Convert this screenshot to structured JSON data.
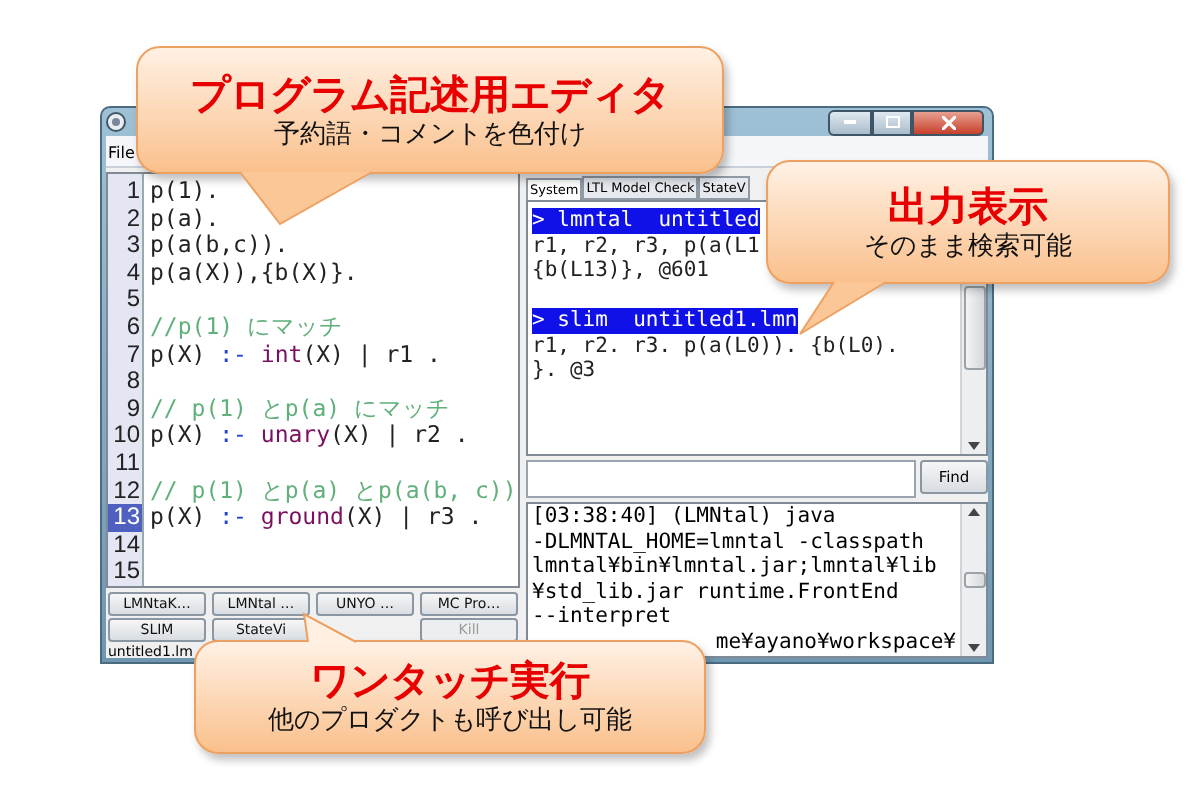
{
  "window": {
    "menu": [
      "File"
    ],
    "editor": {
      "lines": [
        {
          "number": "1",
          "current": false,
          "tokens": [
            {
              "kind": "plain",
              "text": "p(1)."
            }
          ]
        },
        {
          "number": "2",
          "current": false,
          "tokens": [
            {
              "kind": "plain",
              "text": "p(a)."
            }
          ]
        },
        {
          "number": "3",
          "current": false,
          "tokens": [
            {
              "kind": "plain",
              "text": "p(a(b,c))."
            }
          ]
        },
        {
          "number": "4",
          "current": false,
          "tokens": [
            {
              "kind": "plain",
              "text": "p(a(X)),{b(X)}."
            }
          ]
        },
        {
          "number": "5",
          "current": false
        },
        {
          "number": "6",
          "current": false,
          "tokens": [
            {
              "kind": "comment",
              "text": "//p(1) にマッチ"
            }
          ]
        },
        {
          "number": "7",
          "current": false,
          "tokens": [
            {
              "kind": "plain",
              "text": "p(X) "
            },
            {
              "kind": "operator",
              "text": ":- "
            },
            {
              "kind": "keyword",
              "text": "int"
            },
            {
              "kind": "plain",
              "text": "(X) | r1 ."
            }
          ]
        },
        {
          "number": "8",
          "current": false
        },
        {
          "number": "9",
          "current": false,
          "tokens": [
            {
              "kind": "comment",
              "text": "// p(1) とp(a) にマッチ"
            }
          ]
        },
        {
          "number": "10",
          "current": false,
          "tokens": [
            {
              "kind": "plain",
              "text": "p(X) "
            },
            {
              "kind": "operator",
              "text": ":- "
            },
            {
              "kind": "keyword",
              "text": "unary"
            },
            {
              "kind": "plain",
              "text": "(X) | r2 ."
            }
          ]
        },
        {
          "number": "11",
          "current": false
        },
        {
          "number": "12",
          "current": false,
          "tokens": [
            {
              "kind": "comment",
              "text": "// p(1) とp(a) とp(a(b, c))"
            }
          ]
        },
        {
          "number": "13",
          "current": true,
          "tokens": [
            {
              "kind": "plain",
              "text": "p(X) "
            },
            {
              "kind": "operator",
              "text": ":- "
            },
            {
              "kind": "keyword",
              "text": "ground"
            },
            {
              "kind": "plain",
              "text": "(X) | r3 ."
            }
          ]
        },
        {
          "number": "14",
          "current": false
        },
        {
          "number": "15",
          "current": false
        }
      ]
    },
    "run_buttons": [
      [
        {
          "label": "LMNtaK…",
          "disabled": false
        },
        {
          "label": "LMNtal …",
          "disabled": false
        },
        {
          "label": "UNYO …",
          "disabled": false
        },
        {
          "label": "MC Pro…",
          "disabled": false
        }
      ],
      [
        {
          "label": "SLIM",
          "disabled": false
        },
        {
          "label": "StateVi",
          "disabled": false
        },
        {
          "label": "Kill",
          "disabled": true
        }
      ]
    ],
    "status_bar": "untitled1.lm",
    "output_tabs": [
      {
        "label": "System",
        "selected": true
      },
      {
        "label": "LTL Model Check",
        "selected": false
      },
      {
        "label": "StateV",
        "selected": false
      }
    ],
    "output_lines": [
      {
        "kind": "header",
        "text": "> lmntal  untitled"
      },
      {
        "kind": "text",
        "text": "r1, r2, r3, p(a(L1"
      },
      {
        "kind": "text",
        "text": "{b(L13)}, @601"
      },
      {
        "kind": "blank"
      },
      {
        "kind": "header",
        "text": "> slim  untitled1.lmn"
      },
      {
        "kind": "text",
        "text": "r1, r2. r3. p(a(L0)). {b(L0)."
      },
      {
        "kind": "text",
        "text": "}. @3"
      }
    ],
    "find_button": "Find",
    "console_lines": [
      {
        "kind": "full",
        "text": "[03:38:40] (LMNtal) java"
      },
      {
        "kind": "full",
        "text": "-DLMNTAL_HOME=lmntal -classpath"
      },
      {
        "kind": "full",
        "text": "lmntal¥bin¥lmntal.jar;lmntal¥lib"
      },
      {
        "kind": "full",
        "text": "¥std_lib.jar runtime.FrontEnd"
      },
      {
        "kind": "full",
        "text": "--interpret"
      },
      {
        "kind": "tail",
        "text": "me¥ayano¥workspace¥"
      }
    ]
  },
  "callouts": [
    {
      "title": "プログラム記述用エディタ",
      "subtitle": "予約語・コメントを色付け"
    },
    {
      "title": "出力表示",
      "subtitle": "そのまま検索可能"
    },
    {
      "title": "ワンタッチ実行",
      "subtitle": "他のプロダクトも呼び出し可能"
    }
  ]
}
